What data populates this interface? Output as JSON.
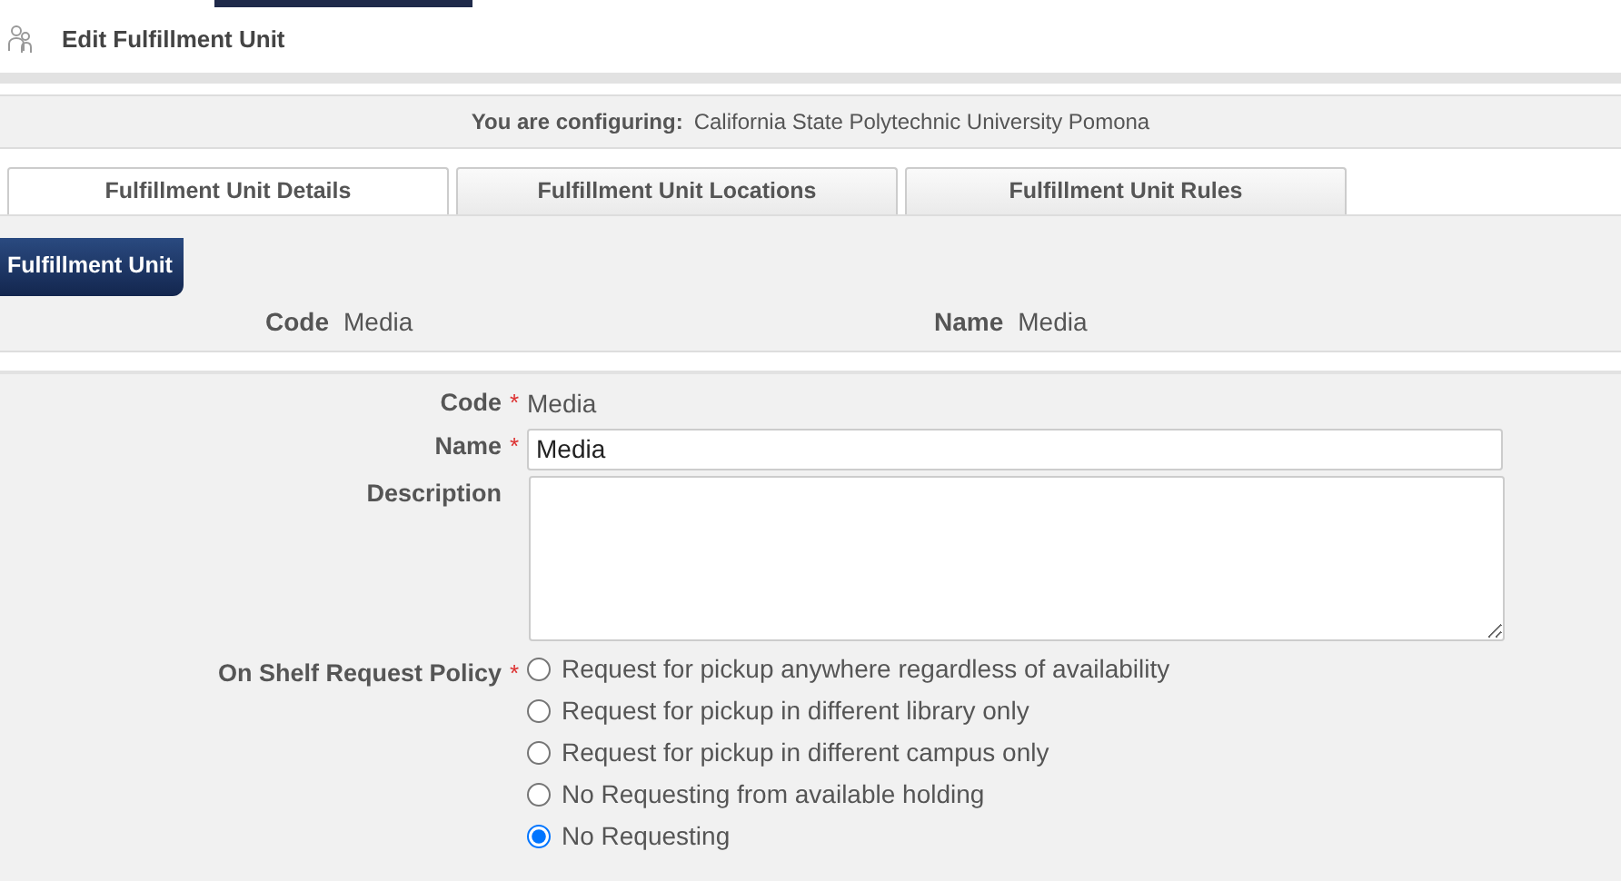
{
  "page_title": "Edit Fulfillment Unit",
  "configuring": {
    "label": "You are configuring:",
    "value": "California State Polytechnic University Pomona"
  },
  "tabs": [
    {
      "label": "Fulfillment Unit Details",
      "selected": true
    },
    {
      "label": "Fulfillment Unit Locations",
      "selected": false
    },
    {
      "label": "Fulfillment Unit Rules",
      "selected": false
    }
  ],
  "section_title": "Fulfillment Unit",
  "summary": [
    {
      "label": "Code",
      "value": "Media"
    },
    {
      "label": "Name",
      "value": "Media"
    }
  ],
  "form": {
    "code": {
      "label": "Code",
      "marker": "*",
      "value": "Media"
    },
    "name": {
      "label": "Name",
      "marker": "*",
      "value": "Media"
    },
    "description": {
      "label": "Description"
    },
    "policy": {
      "label": "On Shelf Request Policy",
      "marker": "*",
      "options": [
        {
          "label": "Request for pickup anywhere regardless of availability",
          "selected": false
        },
        {
          "label": "Request for pickup in different library only",
          "selected": false
        },
        {
          "label": "Request for pickup in different campus only",
          "selected": false
        },
        {
          "label": "No Requesting from available holding",
          "selected": false
        },
        {
          "label": "No Requesting",
          "selected": true
        }
      ]
    }
  }
}
